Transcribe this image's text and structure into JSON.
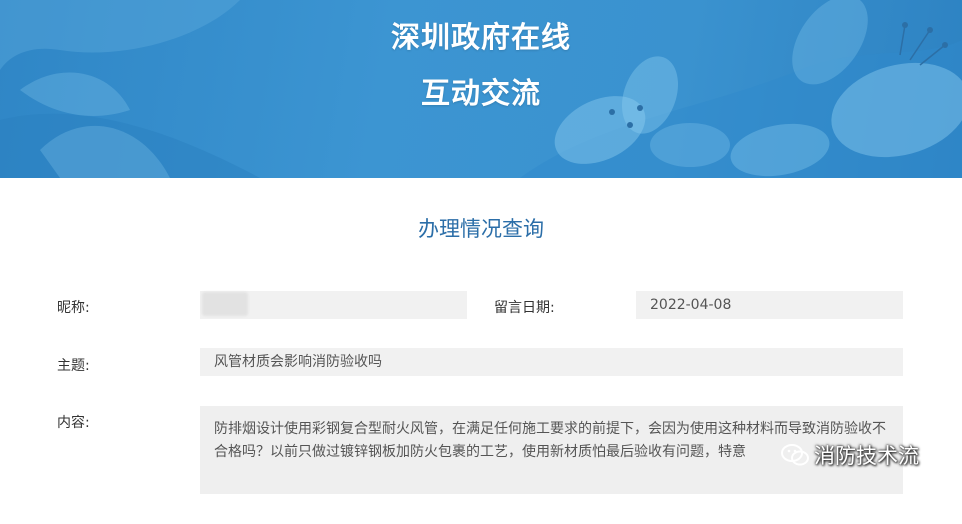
{
  "banner": {
    "title_line1": "深圳政府在线",
    "title_line2": "互动交流"
  },
  "page_title": "办理情况查询",
  "form": {
    "nickname_label": "昵称:",
    "nickname_value": "",
    "date_label": "留言日期:",
    "date_value": "2022-04-08",
    "subject_label": "主题:",
    "subject_value": "风管材质会影响消防验收吗",
    "content_label": "内容:",
    "content_value": "防排烟设计使用彩钢复合型耐火风管，在满足任何施工要求的前提下，会因为使用这种材料而导致消防验收不合格吗？以前只做过镀锌钢板加防火包裹的工艺，使用新材质怕最后验收有问题，特意"
  },
  "watermark": {
    "text": "消防技术流",
    "icon": "wechat-icon"
  },
  "colors": {
    "banner_blue": "#3a92cf",
    "title_blue": "#2b6ea8",
    "field_bg": "#f1f1f1"
  }
}
